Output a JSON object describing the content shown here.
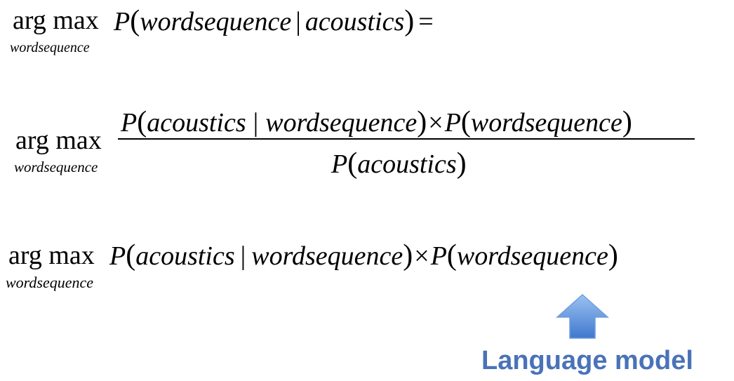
{
  "equation_1": {
    "operator": "arg max",
    "subscript": "wordsequence",
    "func": "P",
    "arg_left": "wordsequence",
    "separator": "|",
    "arg_right": "acoustics",
    "equals": "="
  },
  "equation_2": {
    "operator": "arg max",
    "subscript": "wordsequence",
    "num_func_1": "P",
    "num_arg_left": "acoustics",
    "num_separator": "|",
    "num_arg_right": "wordsequence",
    "times": "×",
    "num_func_2": "P",
    "num_arg_2": "wordsequence",
    "den_func": "P",
    "den_arg": "acoustics"
  },
  "equation_3": {
    "operator": "arg max",
    "subscript": "wordsequence",
    "func_1": "P",
    "arg_left": "acoustics",
    "separator": "|",
    "arg_right": "wordsequence",
    "times": "×",
    "func_2": "P",
    "arg_2": "wordsequence"
  },
  "annotation": {
    "label": "Language model",
    "label_color": "#4a72b8",
    "arrow_color": "#4f86d6",
    "arrow_icon": "up-arrow-icon"
  }
}
